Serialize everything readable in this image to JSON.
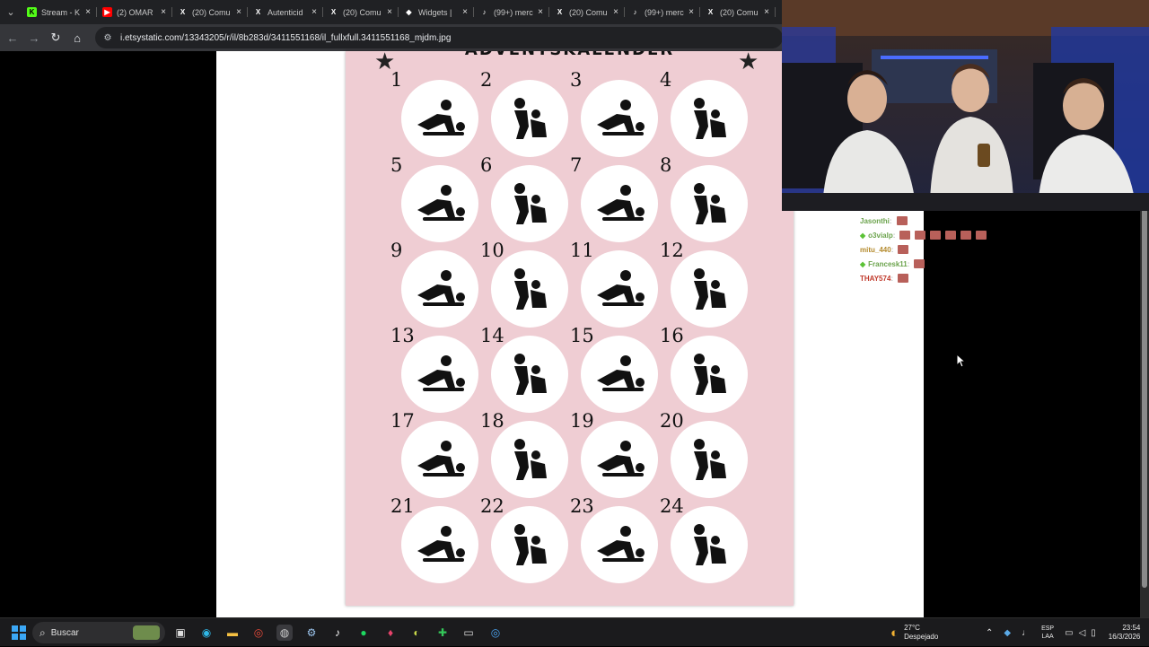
{
  "tabs": [
    {
      "title": "Stream - K",
      "fav_color": "#53fc18",
      "fav_glyph": "K"
    },
    {
      "title": "(2) OMAR",
      "fav_color": "#ff0000",
      "fav_glyph": "▶"
    },
    {
      "title": "(20) Comu",
      "fav_color": "#202124",
      "fav_glyph": "X"
    },
    {
      "title": "Autenticid",
      "fav_color": "#202124",
      "fav_glyph": "X"
    },
    {
      "title": "(20) Comu",
      "fav_color": "#202124",
      "fav_glyph": "X"
    },
    {
      "title": "Widgets |",
      "fav_color": "#202124",
      "fav_glyph": "◆"
    },
    {
      "title": "(99+) merc",
      "fav_color": "#202124",
      "fav_glyph": "♪"
    },
    {
      "title": "(20) Comu",
      "fav_color": "#202124",
      "fav_glyph": "X"
    },
    {
      "title": "(99+) merc",
      "fav_color": "#202124",
      "fav_glyph": "♪"
    },
    {
      "title": "(20) Comu",
      "fav_color": "#202124",
      "fav_glyph": "X"
    }
  ],
  "address_bar": {
    "url": "i.etsystatic.com/13343205/r/il/8b283d/3411551168/il_fullxfull.3411551168_mjdm.jpg"
  },
  "calendar": {
    "title": "ADVENTSKALENDER",
    "days": [
      "1",
      "2",
      "3",
      "4",
      "5",
      "6",
      "7",
      "8",
      "9",
      "10",
      "11",
      "12",
      "13",
      "14",
      "15",
      "16",
      "17",
      "18",
      "19",
      "20",
      "21",
      "22",
      "23",
      "24"
    ]
  },
  "chat": {
    "messages": [
      {
        "user": "Jasonthi",
        "color": "#6ba34c",
        "emotes": 1,
        "badge": false
      },
      {
        "user": "o3vialp",
        "color": "#6ba34c",
        "emotes": 6,
        "badge": true
      },
      {
        "user": "mitu_440",
        "color": "#b48a2c",
        "emotes": 1,
        "badge": false
      },
      {
        "user": "Francesk11",
        "color": "#6ba34c",
        "emotes": 1,
        "badge": true
      },
      {
        "user": "THAY574",
        "color": "#c0392b",
        "emotes": 1,
        "badge": false
      }
    ]
  },
  "taskbar": {
    "search_label": "Buscar",
    "weather_temp": "27°C",
    "weather_desc": "Despejado",
    "lang_top": "ESP",
    "lang_bottom": "LAA",
    "time": "23:54",
    "date": "16/3/2026"
  },
  "colors": {
    "calendar_bg": "#efcdd3",
    "tab_bar": "#202124",
    "taskbar": "#1b1b1d"
  }
}
